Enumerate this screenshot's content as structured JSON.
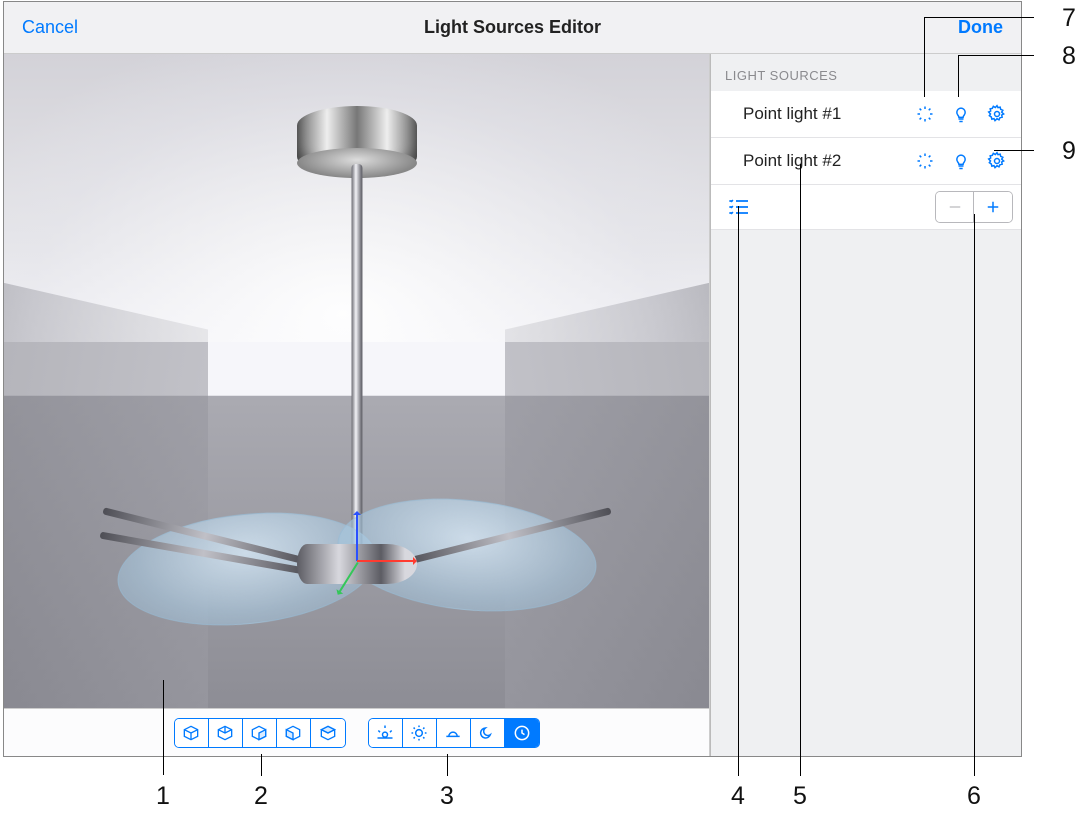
{
  "navbar": {
    "cancel": "Cancel",
    "title": "Light Sources Editor",
    "done": "Done"
  },
  "sidebar": {
    "section_header": "LIGHT SOURCES",
    "items": [
      {
        "label": "Point light #1"
      },
      {
        "label": "Point light #2"
      }
    ]
  },
  "toolbar": {
    "view_group": [
      "cube-persp",
      "cube-top",
      "cube-front",
      "cube-side",
      "cube-back"
    ],
    "env_group": [
      "sunrise",
      "sun-high",
      "sun-flat",
      "moon",
      "clock"
    ],
    "env_selected_index": 4
  },
  "callouts": {
    "1": "1",
    "2": "2",
    "3": "3",
    "4": "4",
    "5": "5",
    "6": "6",
    "7": "7",
    "8": "8",
    "9": "9"
  }
}
